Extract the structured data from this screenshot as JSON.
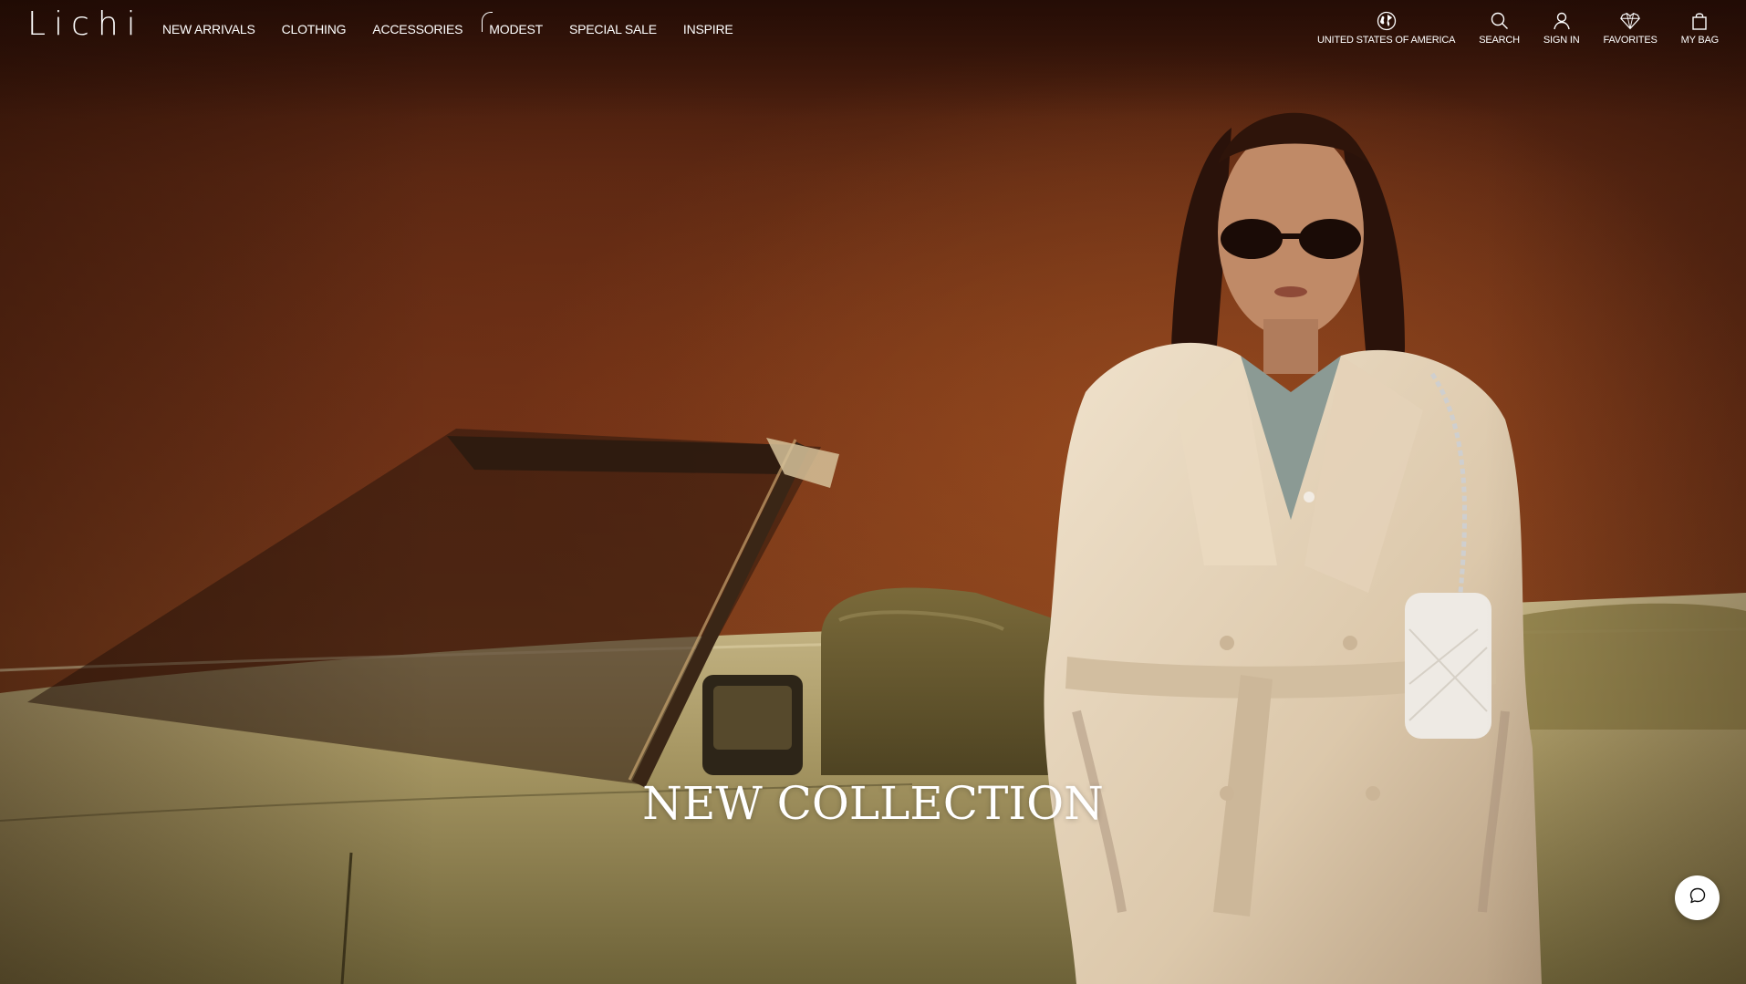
{
  "brand": {
    "logo": "Lichi"
  },
  "nav": {
    "items": [
      {
        "label": "NEW ARRIVALS"
      },
      {
        "label": "CLOTHING"
      },
      {
        "label": "ACCESSORIES"
      },
      {
        "label": "MODEST"
      },
      {
        "label": "SPECIAL SALE"
      },
      {
        "label": "INSPIRE"
      }
    ]
  },
  "utils": {
    "region": {
      "label": "UNITED STATES OF AMERICA",
      "icon": "globe-icon"
    },
    "search": {
      "label": "SEARCH",
      "icon": "search-icon"
    },
    "signin": {
      "label": "SIGN IN",
      "icon": "user-icon"
    },
    "favorites": {
      "label": "FAVORITES",
      "icon": "diamond-heart-icon"
    },
    "bag": {
      "label": "MY BAG",
      "icon": "shopping-bag-icon"
    }
  },
  "hero": {
    "headline": "NEW COLLECTION"
  },
  "chat": {
    "icon": "chat-bubble-icon"
  },
  "colors": {
    "text": "#ffffff",
    "backdrop": "#6e3217",
    "coat": "#e6d6bf",
    "car": "#b8a873"
  }
}
